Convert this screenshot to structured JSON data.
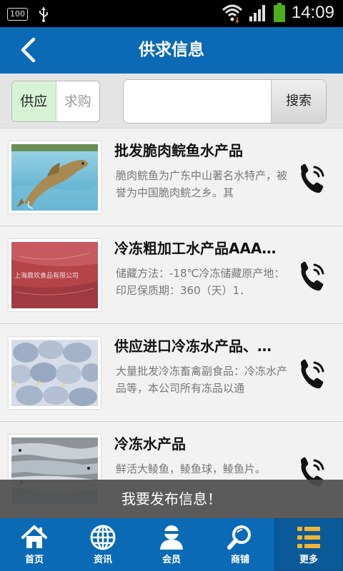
{
  "statusbar": {
    "battery_small": "100",
    "time": "14:09"
  },
  "header": {
    "title": "供求信息"
  },
  "filter": {
    "supply_label": "供应",
    "demand_label": "求购",
    "search_placeholder": "",
    "search_button": "搜索"
  },
  "items": [
    {
      "title": "批发脆肉鲩鱼水产品",
      "desc": "脆肉鲩鱼为广东中山著名水特产，被誉为中国脆肉鲩之乡。其",
      "image": "fish-jumping-image"
    },
    {
      "title": "冷冻粗加工水产品AAA…",
      "desc": "储藏方法：-18℃冷冻储藏原产地：印尼保质期：360（天）1．",
      "image": "frozen-fish-meat-image",
      "watermark": "上海鼎欢食品有限公司"
    },
    {
      "title": "供应进口冷冻水产品、…",
      "desc": "大量批发冷冻畜禽副食品：冷冻水产品等，本公司所有冻品以通",
      "image": "frozen-pomfret-image"
    },
    {
      "title": "冷冻水产品",
      "desc": "鲜活大鲮鱼，鲮鱼球，鲮鱼片。",
      "image": "fresh-fish-image"
    }
  ],
  "publish_banner": "我要发布信息！",
  "bottom_nav": [
    {
      "label": "首页",
      "icon": "home-icon"
    },
    {
      "label": "资讯",
      "icon": "globe-icon"
    },
    {
      "label": "会员",
      "icon": "user-icon"
    },
    {
      "label": "商铺",
      "icon": "search-icon"
    },
    {
      "label": "更多",
      "icon": "list-icon",
      "active": true
    }
  ],
  "colors": {
    "primary": "#0b6ab5",
    "segment_active": "#d6f3d6",
    "banner": "#4e4e4e"
  }
}
